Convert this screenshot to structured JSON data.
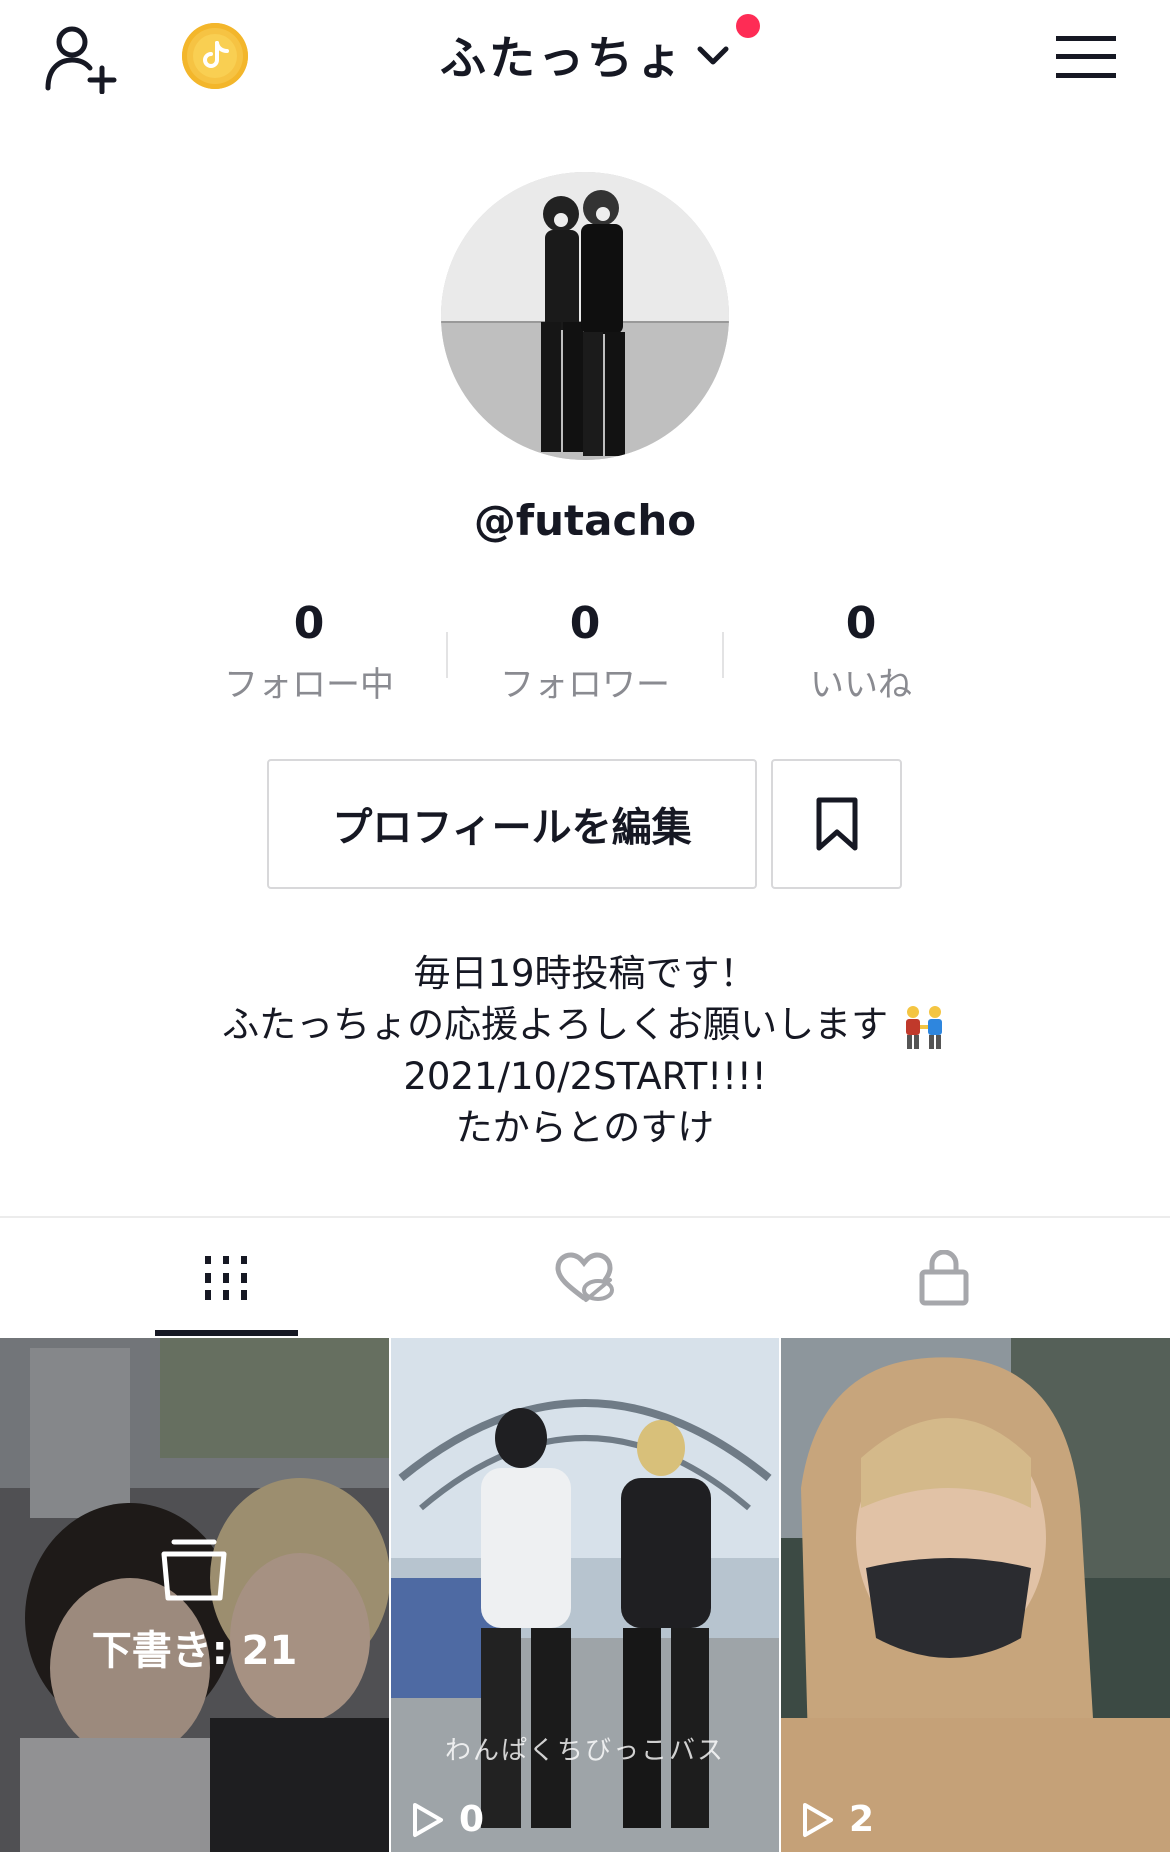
{
  "header": {
    "title": "ふたっちょ",
    "add_user_icon": "person-add-icon",
    "coin_icon": "tiktok-coin-icon",
    "menu_icon": "hamburger-menu-icon",
    "notification_color": "#fe2c55"
  },
  "profile": {
    "username": "@futacho",
    "stats": [
      {
        "value": "0",
        "label": "フォロー中"
      },
      {
        "value": "0",
        "label": "フォロワー"
      },
      {
        "value": "0",
        "label": "いいね"
      }
    ],
    "edit_button": "プロフィールを編集",
    "bio": {
      "line1": "毎日19時投稿です！",
      "line2": "ふたっちょの応援よろしくお願いします",
      "line3": "2021/10/2START!!!!",
      "line4": "たからとのすけ"
    }
  },
  "tabs": [
    {
      "icon": "grid-icon",
      "active": true
    },
    {
      "icon": "liked-hidden-icon",
      "active": false
    },
    {
      "icon": "lock-icon",
      "active": false
    }
  ],
  "videos": [
    {
      "type": "draft",
      "label": "下書き: 21"
    },
    {
      "type": "video",
      "views": "0",
      "caption": "わんぱくちびっこバス"
    },
    {
      "type": "video",
      "views": "2"
    }
  ]
}
